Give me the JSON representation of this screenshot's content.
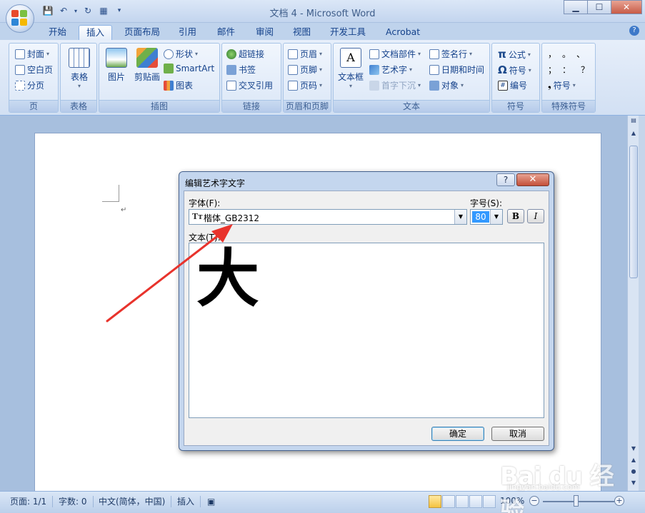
{
  "window": {
    "title": "文档 4 - Microsoft Word"
  },
  "tabs": [
    "开始",
    "插入",
    "页面布局",
    "引用",
    "邮件",
    "审阅",
    "视图",
    "开发工具",
    "Acrobat"
  ],
  "active_tab": "插入",
  "ribbon": {
    "page_group": {
      "label": "页",
      "items": [
        "封面",
        "空白页",
        "分页"
      ]
    },
    "table_group": {
      "label": "表格",
      "button": "表格"
    },
    "illustration_group": {
      "label": "插图",
      "picture": "图片",
      "clipart": "剪贴画",
      "shapes": "形状",
      "smartart": "SmartArt",
      "chart": "图表"
    },
    "links_group": {
      "label": "链接",
      "items": [
        "超链接",
        "书签",
        "交叉引用"
      ]
    },
    "header_footer_group": {
      "label": "页眉和页脚",
      "items": [
        "页眉",
        "页脚",
        "页码"
      ]
    },
    "text_group": {
      "label": "文本",
      "textbox": "文本框",
      "quickparts": "文档部件",
      "wordart": "艺术字",
      "dropcap": "首字下沉",
      "signature": "签名行",
      "datetime": "日期和时间",
      "object": "对象"
    },
    "symbols_group": {
      "label": "符号",
      "equation": "公式",
      "symbol": "符号",
      "number": "编号"
    },
    "special_group": {
      "label": "特殊符号",
      "row1": "，。、",
      "row2": "；：？",
      "symbol": "符号"
    }
  },
  "statusbar": {
    "page": "页面: 1/1",
    "words": "字数: 0",
    "language": "中文(简体，中国)",
    "mode": "插入",
    "zoom": "100%",
    "zoom_fraction": 0.5
  },
  "dialog": {
    "title": "编辑艺术字文字",
    "help": "?",
    "font_label": "字体(F):",
    "font_value": "楷体_GB2312",
    "size_label": "字号(S):",
    "size_value": "80",
    "bold": "B",
    "italic": "I",
    "text_label": "文本(T):",
    "text_value": "大",
    "ok": "确定",
    "cancel": "取消"
  },
  "watermark": {
    "logo_text": "Bai du 经验",
    "url": "jingyan.baidu.com"
  }
}
